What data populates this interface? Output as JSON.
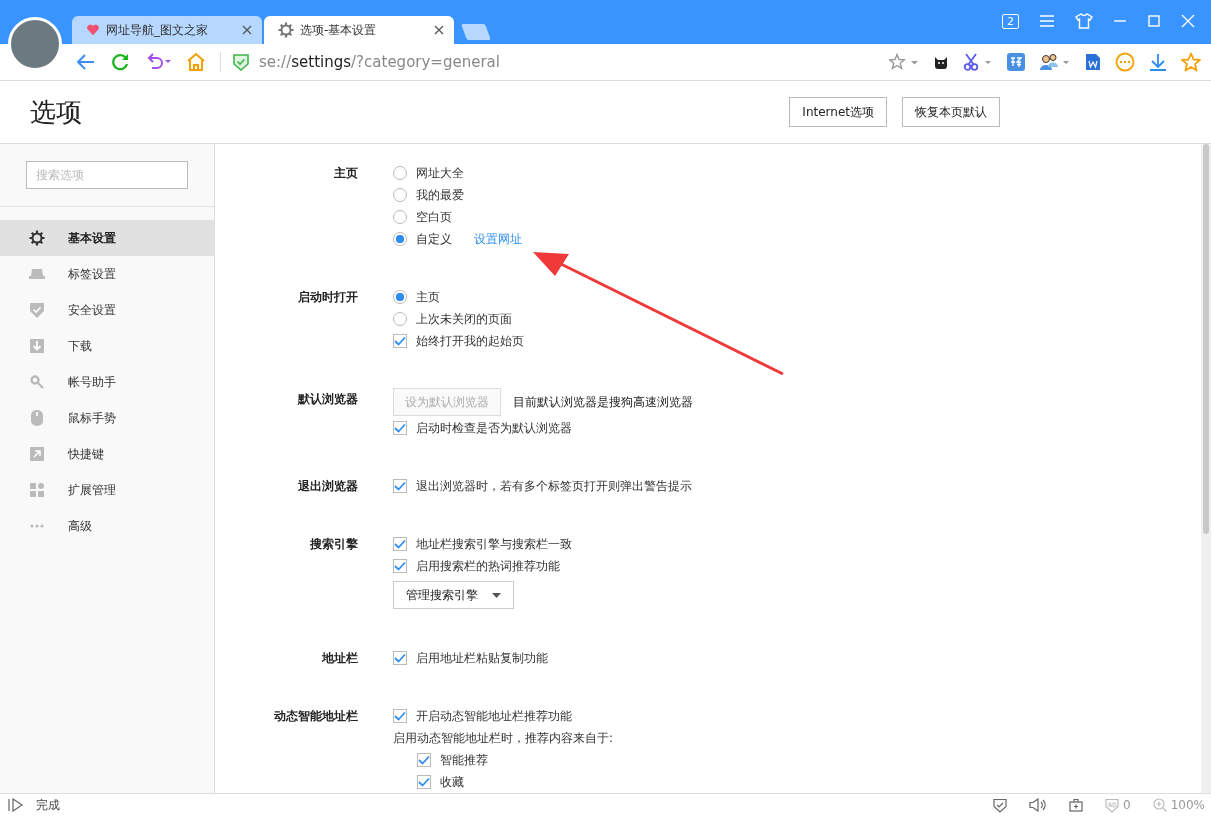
{
  "window": {
    "tab_count": "2"
  },
  "tabs": [
    {
      "title": "网址导航_图文之家",
      "kind": "site",
      "selected": false
    },
    {
      "title": "选项-基本设置",
      "kind": "settings",
      "selected": true
    }
  ],
  "address_bar": {
    "url": "se://**settings**/?category=general"
  },
  "page": {
    "title": "选项",
    "buttons": [
      "Internet选项",
      "恢复本页默认"
    ]
  },
  "sidebar": {
    "search": {
      "placeholder": "搜索选项"
    },
    "items": [
      {
        "label": "基本设置",
        "selected": true
      },
      {
        "label": "标签设置",
        "selected": false
      },
      {
        "label": "安全设置",
        "selected": false
      },
      {
        "label": "下载",
        "selected": false
      },
      {
        "label": "帐号助手",
        "selected": false
      },
      {
        "label": "鼠标手势",
        "selected": false
      },
      {
        "label": "快捷键",
        "selected": false
      },
      {
        "label": "扩展管理",
        "selected": false
      },
      {
        "label": "高级",
        "selected": false
      }
    ]
  },
  "sections": [
    {
      "label": "主页",
      "rows": [
        {
          "kind": "radio",
          "label": "网址大全",
          "selected": false
        },
        {
          "kind": "radio",
          "label": "我的最爱",
          "selected": false
        },
        {
          "kind": "radio",
          "label": "空白页",
          "selected": false
        },
        {
          "kind": "radio",
          "label": "自定义",
          "selected": true,
          "link": "设置网址"
        }
      ]
    },
    {
      "label": "启动时打开",
      "rows": [
        {
          "kind": "radio",
          "label": "主页",
          "selected": true
        },
        {
          "kind": "radio",
          "label": "上次未关闭的页面",
          "selected": false
        },
        {
          "kind": "checkbox",
          "label": "始终打开我的起始页",
          "checked": true
        }
      ]
    },
    {
      "label": "默认浏览器",
      "rows": [
        {
          "kind": "button",
          "label": "设为默认浏览器",
          "disabled": true,
          "note": "目前默认浏览器是搜狗高速浏览器"
        },
        {
          "kind": "checkbox",
          "label": "启动时检查是否为默认浏览器",
          "checked": true
        }
      ]
    },
    {
      "label": "退出浏览器",
      "rows": [
        {
          "kind": "checkbox",
          "label": "退出浏览器时，若有多个标签页打开则弹出警告提示",
          "checked": true
        }
      ]
    },
    {
      "label": "搜索引擎",
      "rows": [
        {
          "kind": "checkbox",
          "label": "地址栏搜索引擎与搜索栏一致",
          "checked": true
        },
        {
          "kind": "checkbox",
          "label": "启用搜索栏的热词推荐功能",
          "checked": true
        },
        {
          "kind": "dropdown",
          "label": "管理搜索引擎"
        }
      ]
    },
    {
      "label": "地址栏",
      "rows": [
        {
          "kind": "checkbox",
          "label": "启用地址栏粘贴复制功能",
          "checked": true
        }
      ]
    },
    {
      "label": "动态智能地址栏",
      "rows": [
        {
          "kind": "checkbox",
          "label": "开启动态智能地址栏推荐功能",
          "checked": true
        },
        {
          "kind": "text",
          "label": "启用动态智能地址栏时，推荐内容来自于:"
        },
        {
          "kind": "subcheckbox",
          "label": "智能推荐",
          "checked": true
        },
        {
          "kind": "subcheckbox",
          "label": "收藏",
          "checked": true
        }
      ]
    }
  ],
  "status_bar": {
    "text": "完成",
    "ad_count": "0",
    "zoom": "100%"
  }
}
